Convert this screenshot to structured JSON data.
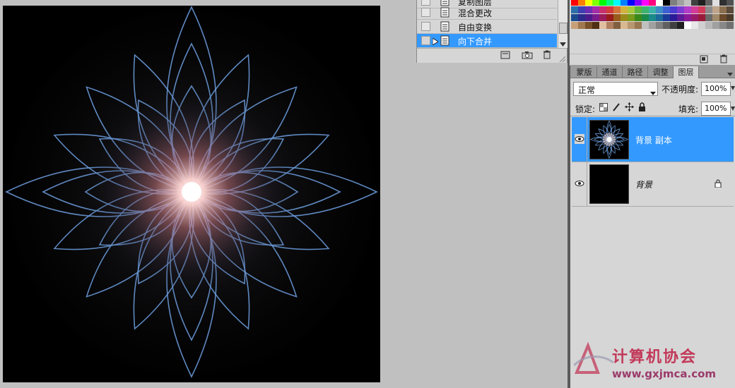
{
  "history": {
    "items": [
      {
        "label": "复制图层",
        "selected": false
      },
      {
        "label": "混合更改",
        "selected": false
      },
      {
        "label": "自由变换",
        "selected": false
      },
      {
        "label": "向下合并",
        "selected": true
      }
    ]
  },
  "swatch_colors": [
    [
      "#ff0000",
      "#ff7f00",
      "#ffff00",
      "#7fff00",
      "#00ff00",
      "#00ff7f",
      "#00ffff",
      "#007fff",
      "#0000ff",
      "#7f00ff",
      "#ff00ff",
      "#ff007f",
      "#ffffff",
      "#000000",
      "#7f7f7f",
      "#a0a0a0",
      "#c0c0c0",
      "#404040",
      "#202020",
      "#606060",
      "#e0e0e0",
      "#303030",
      "#505050"
    ],
    [
      "#2d6fa8",
      "#3f3fb3",
      "#6c2db3",
      "#a32da8",
      "#c8306e",
      "#d23c3c",
      "#d2743c",
      "#d2b23c",
      "#a8c83c",
      "#5fb33f",
      "#3cb36f",
      "#3cb3a8",
      "#3c8cc8",
      "#3c5fd2",
      "#4a3cd2",
      "#7c3cd2",
      "#b33cc8",
      "#d23c96",
      "#d23c5a",
      "#8c8c8c",
      "#bfa58c",
      "#8c6f4f",
      "#5a4a3a"
    ],
    [
      "#1a4a8c",
      "#2a2a8c",
      "#4a1a8c",
      "#7a1a8c",
      "#9a1a5a",
      "#9a1a1a",
      "#9a5a1a",
      "#9a8a1a",
      "#7a9a1a",
      "#3a8a1a",
      "#1a8a4a",
      "#1a8a8a",
      "#1a6a9a",
      "#1a3a9a",
      "#2a1a9a",
      "#5a1a9a",
      "#8a1a9a",
      "#9a1a6a",
      "#9a1a3a",
      "#6a6a6a",
      "#a08a6a",
      "#6a4a2a",
      "#4a3a2a"
    ],
    [
      "#c8a078",
      "#a07850",
      "#785028",
      "#503014",
      "#e0c0a0",
      "#b08060",
      "#806040",
      "#d8b890",
      "#b89870",
      "#987850",
      "#c0c0c0",
      "#a0a0a0",
      "#808080",
      "#606060",
      "#404040",
      "#202020",
      "#ffffff",
      "#e8e8e8",
      "#d0d0d0",
      "#b8b8b8",
      "#a0a0a0",
      "#888888",
      "#707070"
    ]
  ],
  "layers_panel": {
    "tabs": [
      {
        "label": "蒙版",
        "active": false
      },
      {
        "label": "通道",
        "active": false
      },
      {
        "label": "路径",
        "active": false
      },
      {
        "label": "调整",
        "active": false
      },
      {
        "label": "图层",
        "active": true
      }
    ],
    "blend_mode": "正常",
    "opacity_label": "不透明度:",
    "opacity_value": "100%",
    "lock_label": "锁定:",
    "fill_label": "填充:",
    "fill_value": "100%",
    "layers": [
      {
        "name": "背景 副本",
        "selected": true,
        "locked": false
      },
      {
        "name": "背景",
        "selected": false,
        "locked": true
      }
    ]
  },
  "watermark": {
    "text": "计算机协会",
    "url": "www.gxjmca.com"
  }
}
